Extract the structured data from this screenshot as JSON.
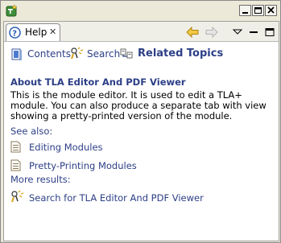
{
  "window": {
    "buttons": [
      "minimize",
      "maximize",
      "close"
    ]
  },
  "tab": {
    "label": "Help",
    "close_glyph": "✕"
  },
  "toolbar": {
    "icons": [
      "back-arrow-icon",
      "forward-arrow-icon",
      "view-menu-icon",
      "minimize-view-icon",
      "maximize-view-icon"
    ],
    "accent": "#f0c020"
  },
  "nav": {
    "contents": "Contents",
    "search": "Search",
    "related": "Related Topics"
  },
  "about": {
    "title": "About TLA Editor And PDF Viewer",
    "text": "This is the module editor.  It is used to edit a TLA+ module.  You can also produce a separate tab with view showing a pretty-printed version of the module."
  },
  "see_also": {
    "label": "See also:",
    "links": [
      "Editing Modules",
      "Pretty-Printing Modules"
    ]
  },
  "more": {
    "label": "More results:",
    "search_link": "Search for TLA Editor And PDF Viewer"
  },
  "colors": {
    "link": "#2c3f86",
    "panel_bg": "#ffffff",
    "chrome_bg": "#ece9d8"
  }
}
